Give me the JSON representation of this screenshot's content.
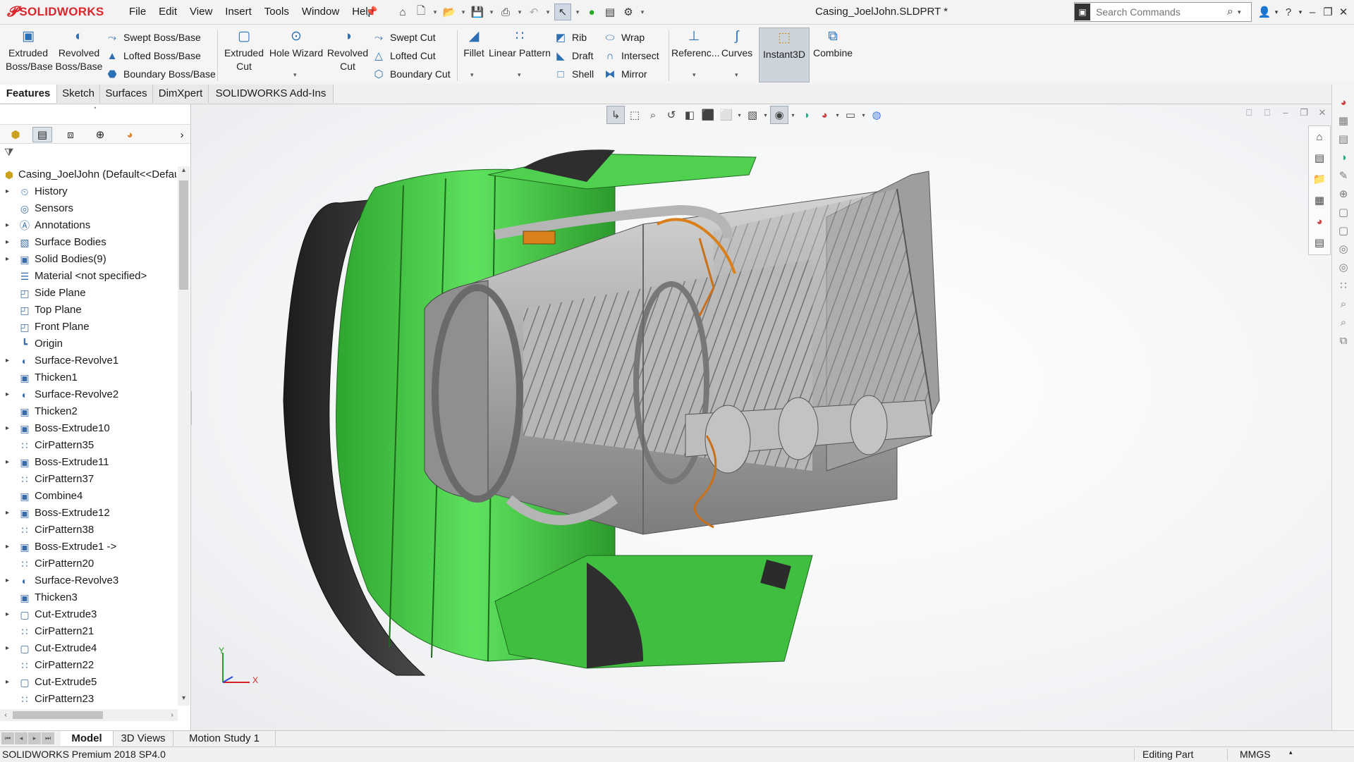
{
  "app": {
    "brand": "SOLIDWORKS",
    "document_title": "Casing_JoelJohn.SLDPRT *"
  },
  "menu": [
    "File",
    "Edit",
    "View",
    "Insert",
    "Tools",
    "Window",
    "Help"
  ],
  "search": {
    "placeholder": "Search Commands"
  },
  "commands": {
    "extruded_boss": "Extruded Boss/Base",
    "revolved_boss": "Revolved Boss/Base",
    "swept_boss": "Swept Boss/Base",
    "lofted_boss": "Lofted Boss/Base",
    "boundary_boss": "Boundary Boss/Base",
    "extruded_cut": "Extruded Cut",
    "hole_wizard": "Hole Wizard",
    "revolved_cut": "Revolved Cut",
    "swept_cut": "Swept Cut",
    "lofted_cut": "Lofted Cut",
    "boundary_cut": "Boundary Cut",
    "fillet": "Fillet",
    "linear_pattern": "Linear Pattern",
    "rib": "Rib",
    "draft": "Draft",
    "shell": "Shell",
    "wrap": "Wrap",
    "intersect": "Intersect",
    "mirror": "Mirror",
    "reference": "Referenc...",
    "curves": "Curves",
    "instant3d": "Instant3D",
    "combine": "Combine"
  },
  "tabs": [
    "Features",
    "Sketch",
    "Surfaces",
    "DimXpert",
    "SOLIDWORKS Add-Ins"
  ],
  "tree": {
    "root": "Casing_JoelJohn  (Default<<Default>",
    "items": [
      "History",
      "Sensors",
      "Annotations",
      "Surface Bodies",
      "Solid Bodies(9)",
      "Material <not specified>",
      "Side Plane",
      "Top Plane",
      "Front Plane",
      "Origin",
      "Surface-Revolve1",
      "Thicken1",
      "Surface-Revolve2",
      "Thicken2",
      "Boss-Extrude10",
      "CirPattern35",
      "Boss-Extrude11",
      "CirPattern37",
      "Combine4",
      "Boss-Extrude12",
      "CirPattern38",
      "Boss-Extrude1 ->",
      "CirPattern20",
      "Surface-Revolve3",
      "Thicken3",
      "Cut-Extrude3",
      "CirPattern21",
      "Cut-Extrude4",
      "CirPattern22",
      "Cut-Extrude5",
      "CirPattern23"
    ]
  },
  "triad": {
    "x": "X",
    "y": "Y"
  },
  "bottom_tabs": [
    "Model",
    "3D Views",
    "Motion Study 1"
  ],
  "status": {
    "version": "SOLIDWORKS Premium 2018 SP4.0",
    "mode": "Editing Part",
    "units": "MMGS"
  },
  "colors": {
    "casing_green": "#4fd04f",
    "casing_dark": "#2b2b2b",
    "metal": "#a9a9a9",
    "pipe_orange": "#d9801a"
  }
}
